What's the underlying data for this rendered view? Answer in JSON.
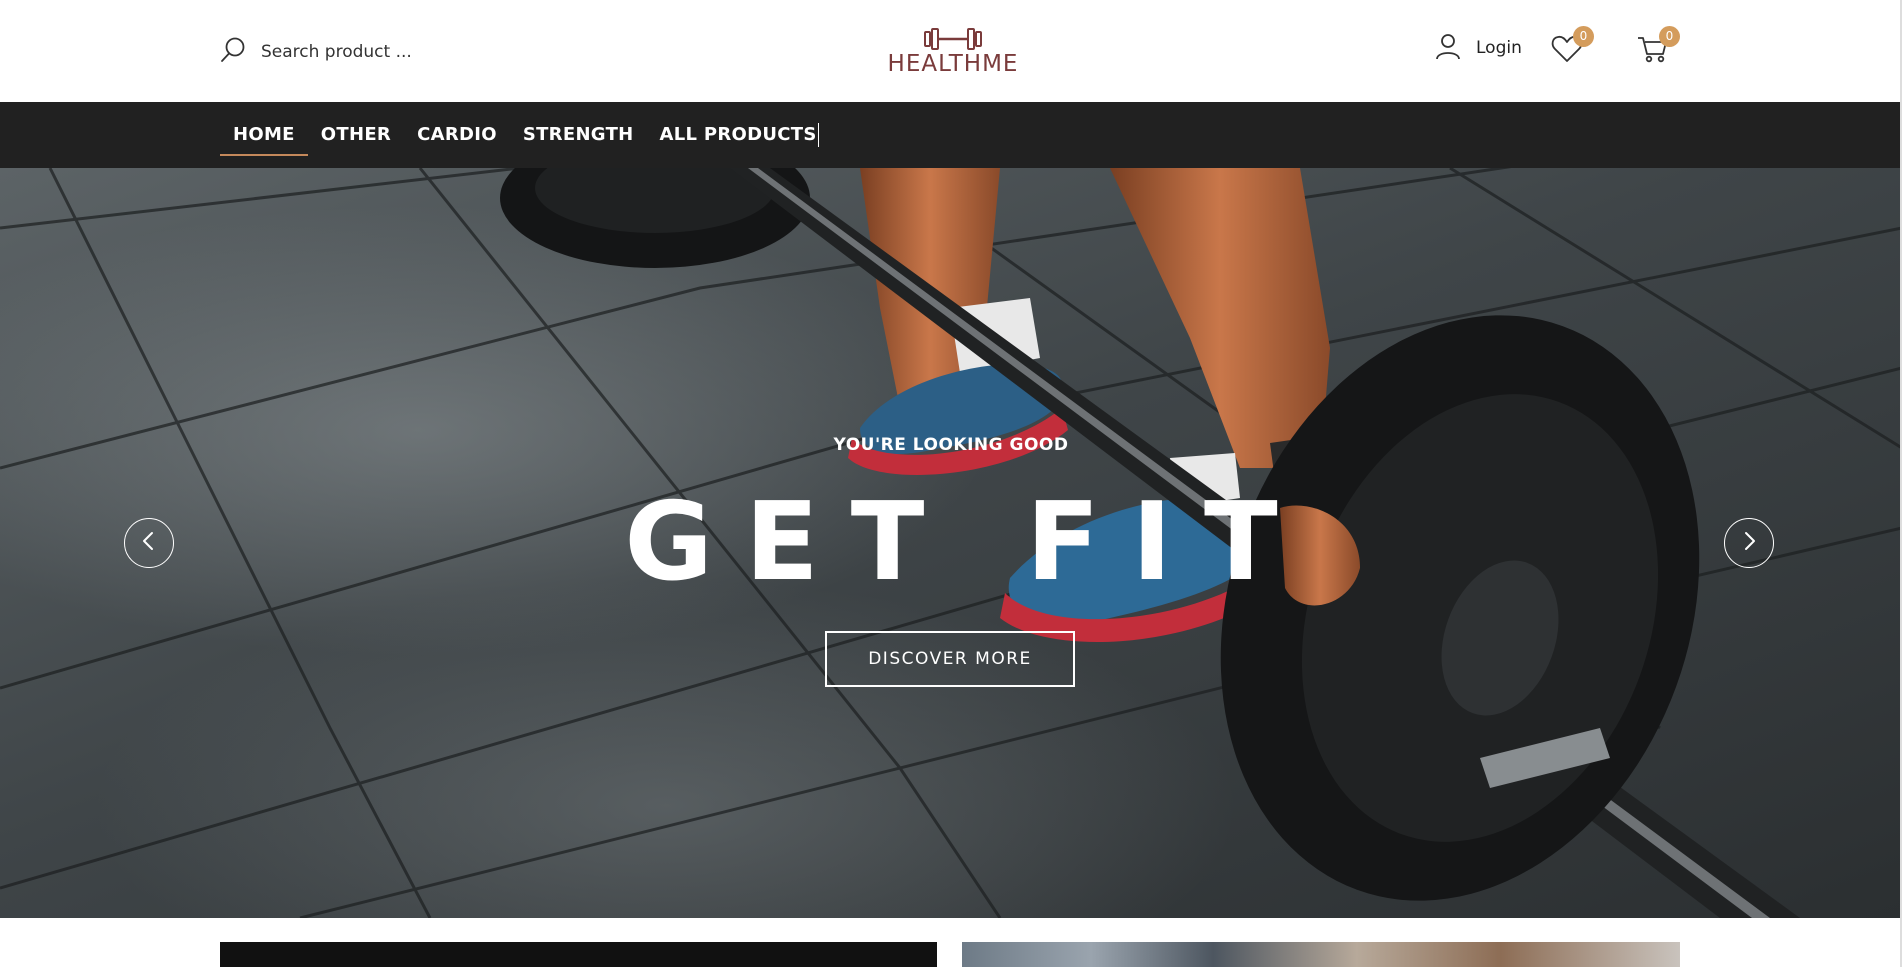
{
  "header": {
    "search": {
      "placeholder": "Search product ...",
      "value": ""
    },
    "logo": {
      "text": "HEALTHME",
      "icon": "dumbbell-icon",
      "color": "#7a3b3b"
    },
    "login_label": "Login",
    "wishlist_count": "0",
    "cart_count": "0",
    "badge_color": "#d49c5c"
  },
  "nav": {
    "items": [
      {
        "label": "HOME",
        "active": true
      },
      {
        "label": "OTHER",
        "active": false
      },
      {
        "label": "CARDIO",
        "active": false
      },
      {
        "label": "STRENGTH",
        "active": false
      },
      {
        "label": "ALL PRODUCTS",
        "active": false
      }
    ],
    "background": "#212121",
    "active_underline": "#c4895b"
  },
  "hero": {
    "subtitle": "YOU'RE LOOKING GOOD",
    "title": "GET FIT",
    "button_label": "DISCOVER MORE",
    "prev_icon": "chevron-left-icon",
    "next_icon": "chevron-right-icon"
  }
}
